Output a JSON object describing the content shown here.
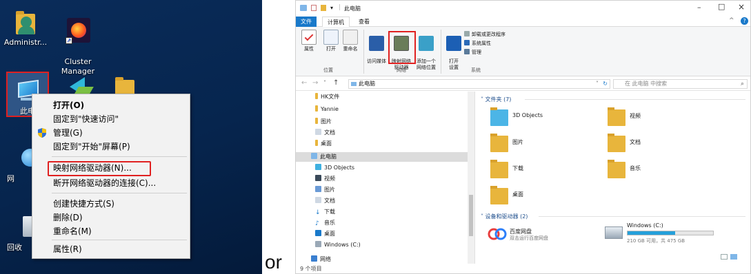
{
  "desktop": {
    "icons": [
      {
        "label": "Administr..."
      },
      {
        "label": "Cluster\nManager"
      },
      {
        "label": "此电"
      },
      {
        "label": "网"
      },
      {
        "label": "回收"
      }
    ],
    "context_menu": {
      "items": [
        {
          "label": "打开(O)",
          "bold": true
        },
        {
          "label": "固定到\"快速访问\""
        },
        {
          "label": "管理(G)"
        },
        {
          "label": "固定到\"开始\"屏幕(P)"
        },
        {
          "label": "映射网络驱动器(N)..."
        },
        {
          "label": "断开网络驱动器的连接(C)..."
        },
        {
          "label": "创建快捷方式(S)"
        },
        {
          "label": "删除(D)"
        },
        {
          "label": "重命名(M)"
        },
        {
          "label": "属性(R)"
        }
      ]
    }
  },
  "separator_text": "or",
  "explorer": {
    "title": "此电脑",
    "window_controls": {
      "minimize": "–",
      "maximize": "□",
      "close": "×"
    },
    "tabs": [
      "文件",
      "计算机",
      "查看"
    ],
    "ribbon": {
      "groups": {
        "location": "位置",
        "network": "网络",
        "system": "系统"
      },
      "buttons": {
        "properties": "属性",
        "open": "打开",
        "rename": "重命名",
        "access_media": "访问媒体",
        "map_drive": "映射网络\n驱动器",
        "add_location": "添加一个\n网络位置",
        "open_settings": "打开\n设置"
      },
      "system_items": {
        "uninstall": "卸载或更改程序",
        "sys_properties": "系统属性",
        "manage": "管理"
      }
    },
    "address": {
      "path": "此电脑",
      "search_placeholder": "在 此电脑 中搜索"
    },
    "nav": {
      "items": [
        "HK文件",
        "Yannie",
        "图片",
        "文档",
        "桌面",
        "此电脑",
        "3D Objects",
        "视频",
        "图片",
        "文档",
        "下载",
        "音乐",
        "桌面",
        "Windows (C:)",
        "网络"
      ]
    },
    "folders_section": {
      "title": "文件夹 (7)",
      "items": [
        "3D Objects",
        "视频",
        "图片",
        "文档",
        "下载",
        "音乐",
        "桌面"
      ]
    },
    "drives_section": {
      "title": "设备和驱动器 (2)",
      "baidu": {
        "name": "百度网盘",
        "sub": "双击运行百度网盘"
      },
      "windows": {
        "name": "Windows (C:)",
        "free": "210 GB 可用，共 475 GB",
        "used_fraction": 0.56
      }
    },
    "status": "9 个项目"
  },
  "colors": {
    "accent_blue": "#1979ca",
    "highlight_red": "#e02020",
    "folder_yellow": "#e8b53c"
  }
}
